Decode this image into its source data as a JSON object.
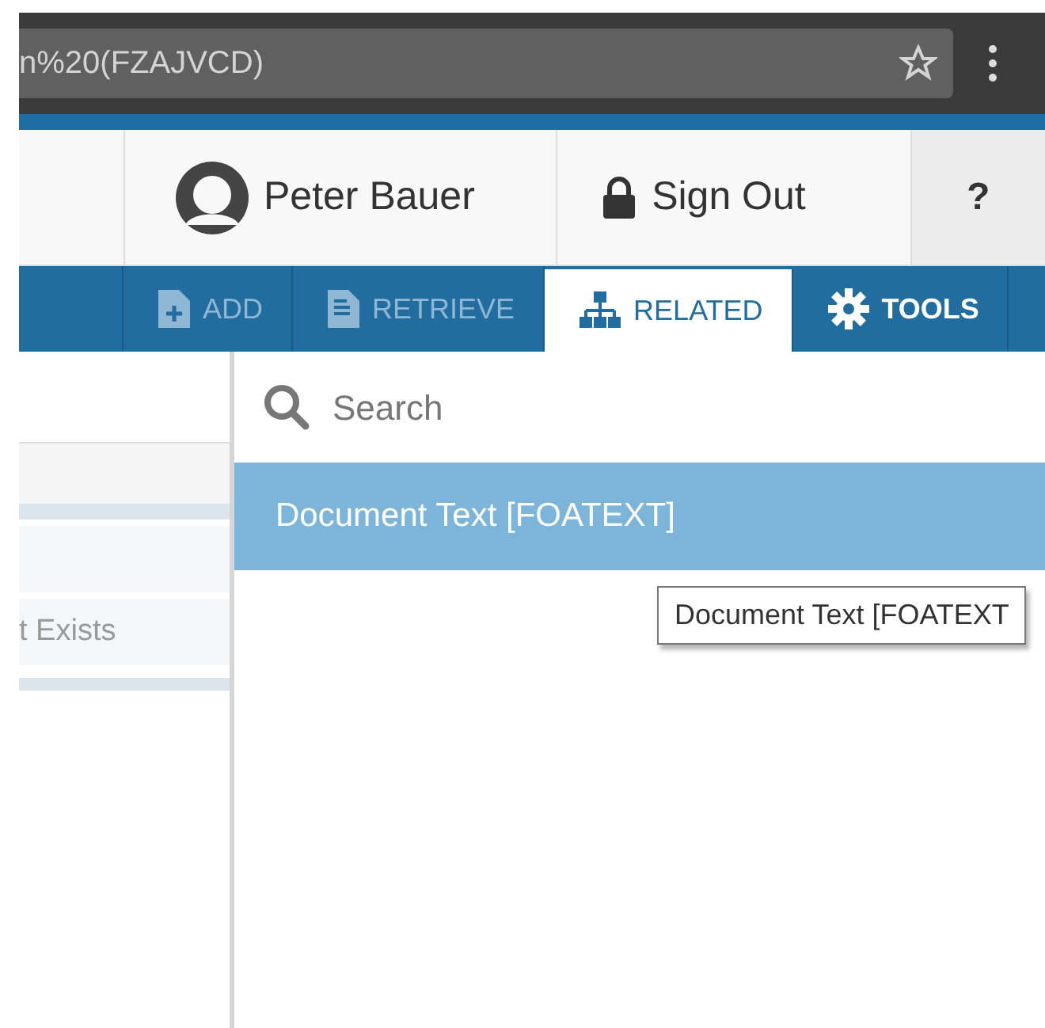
{
  "browser": {
    "url": "n%20(FZAJVCD)"
  },
  "header": {
    "user": "Peter Bauer",
    "sign_out": "Sign Out",
    "help": "?"
  },
  "toolbar": [
    {
      "label": "ADD",
      "kind": "add",
      "selected": false,
      "disabled": true
    },
    {
      "label": "RETRIEVE",
      "kind": "retrieve",
      "selected": false,
      "disabled": true
    },
    {
      "label": "RELATED",
      "kind": "related",
      "selected": true,
      "disabled": false
    },
    {
      "label": "TOOLS",
      "kind": "tools",
      "selected": false,
      "disabled": false
    }
  ],
  "left_panel": {
    "rows": [
      {
        "text": "t Exists"
      }
    ]
  },
  "search": {
    "placeholder": "Search"
  },
  "related_items": [
    {
      "label": "Document Text [FOATEXT]",
      "selected": true
    }
  ],
  "tooltip": "Document Text [FOATEXT"
}
